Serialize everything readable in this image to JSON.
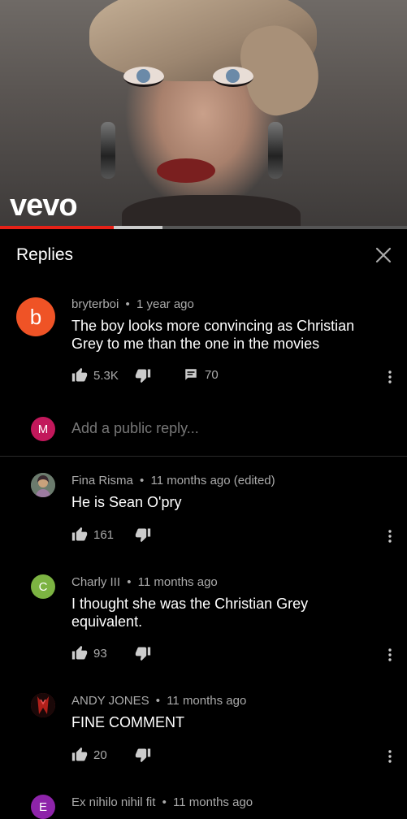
{
  "video": {
    "brand": "vevo",
    "progress_played": 0.28,
    "buffered_from": 0.28,
    "buffered_to": 0.4
  },
  "header": {
    "title": "Replies",
    "close_icon": "close-icon"
  },
  "parent_comment": {
    "avatar_letter": "b",
    "avatar_color": "#ef5326",
    "author": "bryterboi",
    "time": "1 year ago",
    "text": "The boy looks more convincing as Christian Grey to me than the one in the movies",
    "likes": "5.3K",
    "replies": "70"
  },
  "reply_box": {
    "avatar_letter": "M",
    "avatar_color": "#c2185b",
    "placeholder": "Add a public reply..."
  },
  "replies": [
    {
      "avatar_letter": "",
      "avatar_color": "#6b7b6d",
      "author": "Fina Risma",
      "time": "11 months ago (edited)",
      "text": "He is Sean O'pry",
      "likes": "161"
    },
    {
      "avatar_letter": "C",
      "avatar_color": "#7cb342",
      "author": "Charly III",
      "time": "11 months ago",
      "text": "I thought she was the Christian Grey equivalent.",
      "likes": "93"
    },
    {
      "avatar_letter": "",
      "avatar_color": "#8b1a1a",
      "author": "ANDY JONES",
      "time": "11 months ago",
      "text": "FINE COMMENT",
      "likes": "20"
    },
    {
      "avatar_letter": "E",
      "avatar_color": "#8e24aa",
      "author": "Ex nihilo nihil fit",
      "time": "11 months ago",
      "text": "",
      "likes": ""
    }
  ],
  "separator": "•"
}
